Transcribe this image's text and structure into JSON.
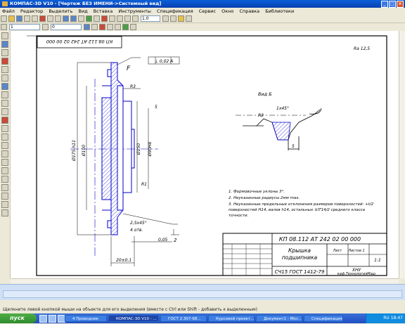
{
  "window": {
    "title": "КОМПАС-3D V10 - [Чертеж БЕЗ ИМЕНИ->Системный вид]",
    "controls": {
      "minimize": "_",
      "maximize": "□",
      "close": "×"
    }
  },
  "menu": {
    "items": [
      "Файл",
      "Редактор",
      "Выделить",
      "Вид",
      "Вставка",
      "Инструменты",
      "Спецификация",
      "Сервис",
      "Окно",
      "Справка",
      "Библиотеки"
    ]
  },
  "toolbar": {
    "zoom": "1.0",
    "style_field": "1",
    "layer_field": "0"
  },
  "drawing": {
    "designation": "КП 08.112 АТ 242 02 00 000",
    "designation_rotated": "КП 08.112 АТ 242 02 00 000",
    "part_name_line1": "Крышка",
    "part_name_line2": "подшипника",
    "material": "СЧ15 ГОСТ 1412-79",
    "scale": "1:1",
    "sheet": "Лист",
    "sheets": "Листов 1",
    "org_line1": "ХНУ",
    "org_line2": "каф.ТехнологияМаш",
    "roughness_general": "Ra 12,5",
    "tolerance_frame": "⊥ 0,02 A",
    "detail_view": "Вид Б",
    "flange_label": "F",
    "chamfer": "2,5х45°",
    "holes": "4 отв.",
    "runout": "0,05",
    "dim_bottom": "20±0,1",
    "dia_outer": "Ø175-h11",
    "dia_bore": "Ø100",
    "dia_pcd": "Ø150",
    "dia_inner": "Ø90H8",
    "dim_r": "R3",
    "dim_r2": "R1",
    "dim_45": "1х45°",
    "dim_5": "5",
    "dim_2": "2",
    "notes": [
      "1. Формовочные уклоны 3°.",
      "2. Неуказанные радиусы 2мм max.",
      "3. Неуказанные предельные отклонения размеров поверхностей: +t/2",
      "   поверхностей H14, валов h14, остальных ±IT14/2 среднего класса",
      "   точности."
    ]
  },
  "statusbar": {
    "text": "Щелкните левой кнопкой мыши на объекте для его выделения (вместе с Ctrl или Shift - добавить к выделенным)"
  },
  "taskbar": {
    "start": "пуск",
    "buttons": [
      "4 Проводник",
      "КОМПАС-3D V10 - ...",
      "ГОСТ 2.307-68...",
      "Курсовой проект...",
      "Документ1 - Micr...",
      "Спецификация..."
    ],
    "clock": "RU 18:47"
  },
  "colors": {
    "accent": "#0a5fd8",
    "drawing_line": "#0000cc",
    "taskbar": "#1e4fc2",
    "start_button": "#2e8b2e"
  }
}
